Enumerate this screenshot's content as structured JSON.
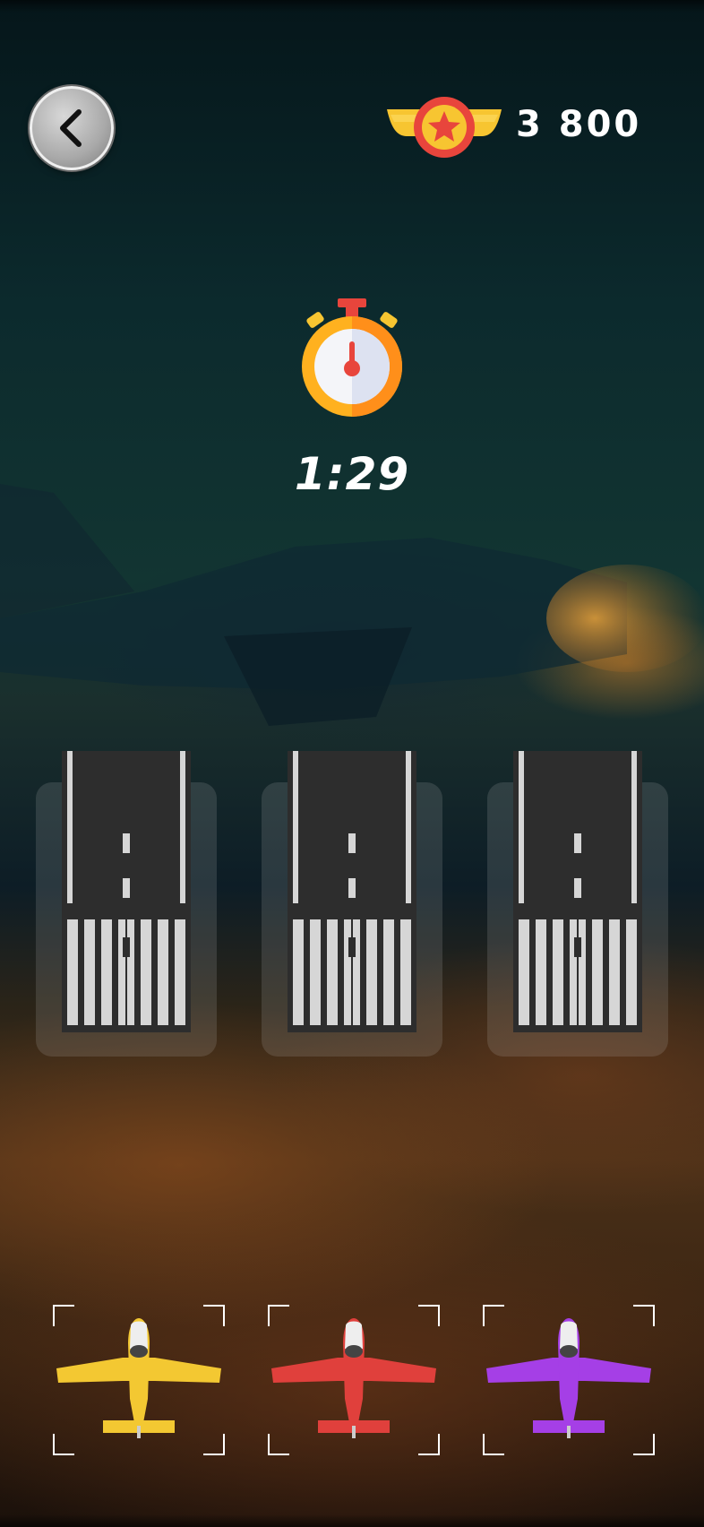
{
  "header": {
    "back_icon": "chevron-left-icon",
    "score_icon": "winged-star-badge-icon",
    "score": "3 800"
  },
  "timer": {
    "icon": "stopwatch-icon",
    "value": "1:29"
  },
  "runways": [
    {
      "id": "runway-1"
    },
    {
      "id": "runway-2"
    },
    {
      "id": "runway-3"
    }
  ],
  "planes": [
    {
      "color_name": "yellow",
      "color": "#f3c832"
    },
    {
      "color_name": "red",
      "color": "#e0403c"
    },
    {
      "color_name": "purple",
      "color": "#a53fe6"
    }
  ],
  "colors": {
    "badge_gold": "#f7c531",
    "badge_red": "#e8453c",
    "stopwatch_orange": "#ff9f1a",
    "runway_asphalt": "#2d2d2d",
    "runway_marking": "#d6d6d6"
  }
}
